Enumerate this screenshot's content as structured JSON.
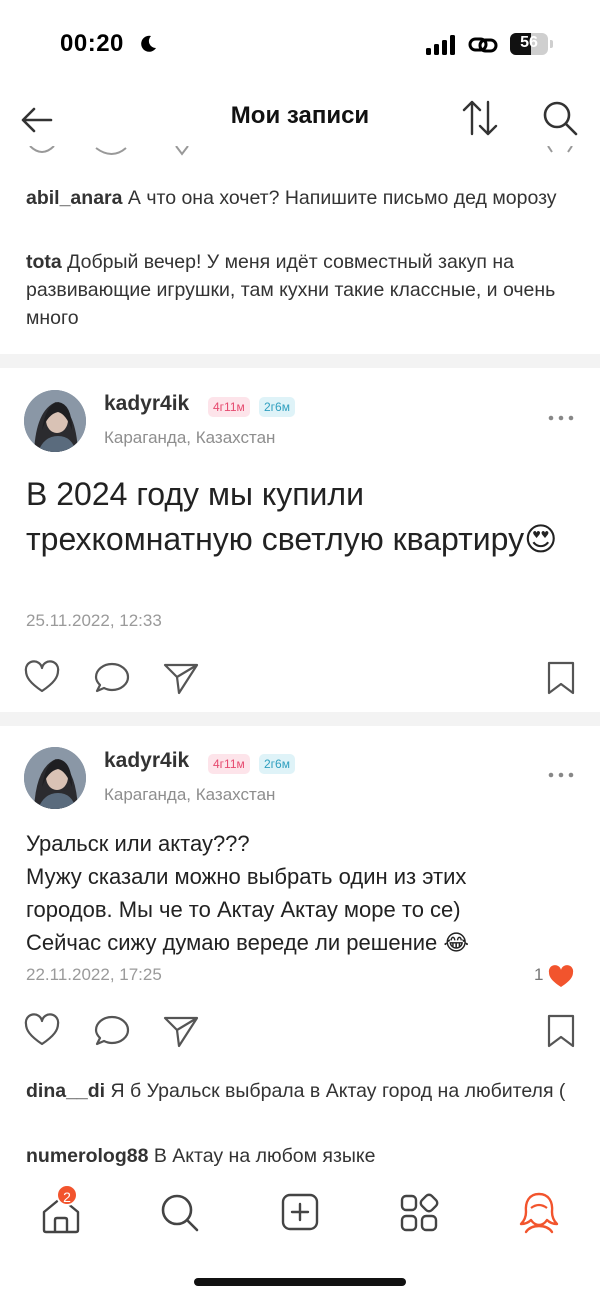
{
  "status_bar": {
    "time": "00:20",
    "battery_level": "56",
    "icons": [
      "moon-icon",
      "cellular-signal-icon",
      "link-icon",
      "battery-icon"
    ]
  },
  "header": {
    "title": "Мои записи",
    "icons": [
      "back-arrow-icon",
      "sort-icon",
      "search-icon"
    ]
  },
  "top_comments": [
    {
      "author": "abil_anara",
      "text": "А что она хочет? Напишите письмо дед морозу"
    },
    {
      "author": "tota",
      "text": "Добрый вечер! У меня идёт совместный закуп на развивающие игрушки, там кухни такие классные, и очень много"
    }
  ],
  "posts": [
    {
      "username": "kadyr4ik",
      "tag_child1": "4г11м",
      "tag_child2": "2г6м",
      "location": "Караганда, Казахстан",
      "text": "В 2024 году мы купили трехкомнатную светлую квартиру😍",
      "date": "25.11.2022, 12:33"
    },
    {
      "username": "kadyr4ik",
      "tag_child1": "4г11м",
      "tag_child2": "2г6м",
      "location": "Караганда, Казахстан",
      "text_lines": [
        "Уральск или актау???",
        "Мужу сказали можно выбрать один из этих",
        "городов. Мы че то Актау Актау море то се)",
        "Сейчас сижу думаю вереде ли решение 😂"
      ],
      "date": "22.11.2022, 17:25",
      "likes_count": "1"
    }
  ],
  "bottom_comments": [
    {
      "author": "dina__di",
      "text": "Я б Уральск выбрала в Актау город на любителя ("
    },
    {
      "author": "numerolog88",
      "text": "В Актау на любом языке"
    }
  ],
  "tabbar": {
    "home_badge": "2",
    "tabs": [
      "home-icon",
      "search-icon",
      "add-post-icon",
      "services-icon",
      "profile-icon"
    ]
  },
  "colors": {
    "accent_orange": "#f2542d",
    "tag_pink_bg": "#fde4ea",
    "tag_blue_bg": "#dff3f8",
    "separator": "#f3f3f3"
  }
}
